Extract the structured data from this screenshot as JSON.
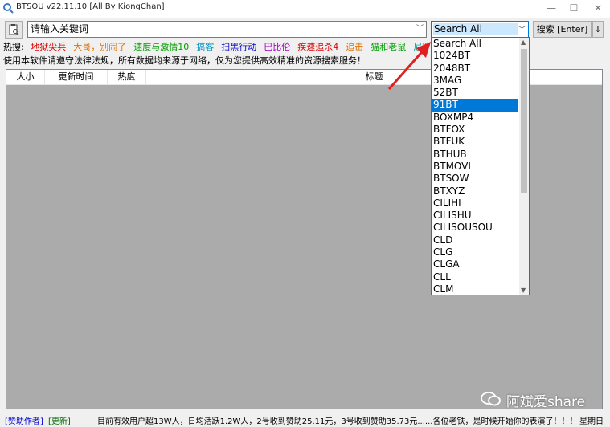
{
  "window": {
    "title": "BTSOU v22.11.10 [All By KiongChan]",
    "controls": {
      "minimize": "—",
      "maximize": "☐",
      "close": "✕"
    }
  },
  "search": {
    "placeholder": "请输入关键词",
    "source_selected": "Search All",
    "button_label": "搜索 [Enter]",
    "sort_label": "↓"
  },
  "hot": {
    "label": "热搜:",
    "keywords": [
      {
        "text": "地狱尖兵",
        "color": "#e00000"
      },
      {
        "text": "大哥，别闹了",
        "color": "#e07000"
      },
      {
        "text": "速度与激情10",
        "color": "#00a000"
      },
      {
        "text": "搞客",
        "color": "#0090c0"
      },
      {
        "text": "扫黑行动",
        "color": "#0000cc"
      },
      {
        "text": "巴比伦",
        "color": "#a000c0"
      },
      {
        "text": "疾速追杀4",
        "color": "#e00000"
      },
      {
        "text": "追击",
        "color": "#e07000"
      },
      {
        "text": "猫和老鼠",
        "color": "#00a000"
      },
      {
        "text": "尼罗河上的",
        "color": "#00a0a0"
      }
    ]
  },
  "notice": "使用本软件请遵守法律法规，所有数据均来源于网络，仅为您提供高效精准的资源搜索服务！",
  "table": {
    "columns": [
      "大小",
      "更新时间",
      "热度",
      "标题"
    ]
  },
  "dropdown": {
    "selected_index": 5,
    "items": [
      "Search All",
      "1024BT",
      "2048BT",
      "3MAG",
      "52BT",
      "91BT",
      "BOXMP4",
      "BTFOX",
      "BTFUK",
      "BTHUB",
      "BTMOVI",
      "BTSOW",
      "BTXYZ",
      "CILIHI",
      "CILISHU",
      "CILISOUSOU",
      "CLD",
      "CLG",
      "CLGA",
      "CLL",
      "CLM"
    ]
  },
  "status": {
    "sponsor_link": "[赞助作者]",
    "update_link": "[更新]",
    "message": "目前有效用户超13W人，日均活跃1.2W人，2号收到赞助25.11元，3号收到赞助35.73元......各位老铁，是时候开始你的表演了！！！",
    "day": "星期日"
  },
  "watermark": {
    "text": "阿斌爱share"
  },
  "colors": {
    "accent": "#0078d7",
    "annotation_arrow": "#e02020"
  }
}
